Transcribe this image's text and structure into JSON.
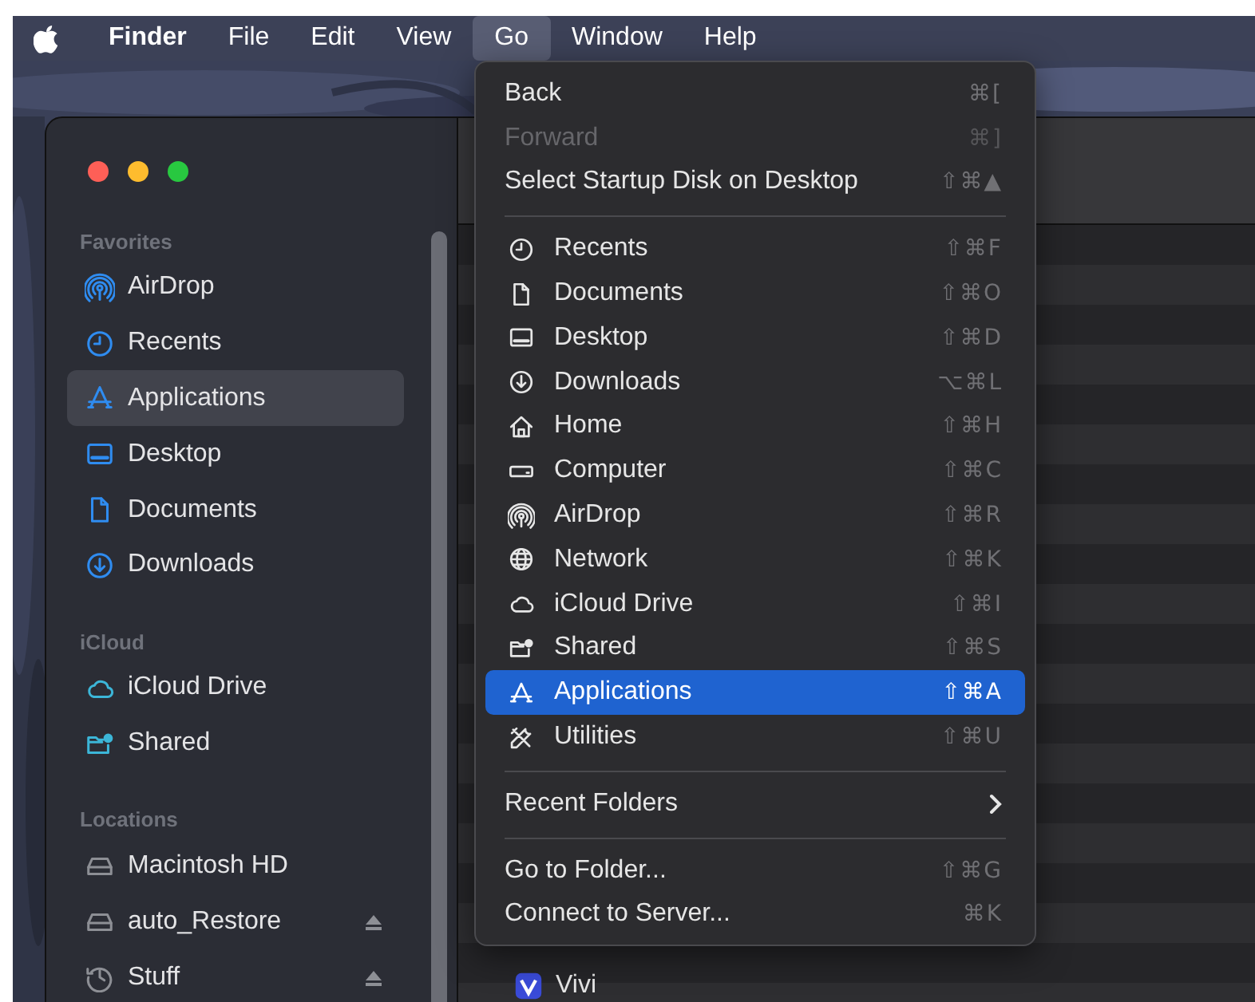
{
  "menu_bar": {
    "items": [
      {
        "label": "Finder",
        "kind": "app",
        "selected": false
      },
      {
        "label": "File",
        "kind": "menu",
        "selected": false
      },
      {
        "label": "Edit",
        "kind": "menu",
        "selected": false
      },
      {
        "label": "View",
        "kind": "menu",
        "selected": false
      },
      {
        "label": "Go",
        "kind": "menu",
        "selected": true
      },
      {
        "label": "Window",
        "kind": "menu",
        "selected": false
      },
      {
        "label": "Help",
        "kind": "menu",
        "selected": false
      }
    ]
  },
  "finder_window": {
    "sidebar": {
      "sections": [
        {
          "heading": "Favorites",
          "kind": "favorites",
          "items": [
            {
              "label": "AirDrop",
              "kind": "airdrop",
              "selected": false,
              "ejectable": false
            },
            {
              "label": "Recents",
              "kind": "clock",
              "selected": false,
              "ejectable": false
            },
            {
              "label": "Applications",
              "kind": "apps",
              "selected": true,
              "ejectable": false
            },
            {
              "label": "Desktop",
              "kind": "desktop",
              "selected": false,
              "ejectable": false
            },
            {
              "label": "Documents",
              "kind": "document",
              "selected": false,
              "ejectable": false
            },
            {
              "label": "Downloads",
              "kind": "download",
              "selected": false,
              "ejectable": false
            }
          ]
        },
        {
          "heading": "iCloud",
          "kind": "icloud",
          "items": [
            {
              "label": "iCloud Drive",
              "kind": "cloud",
              "selected": false,
              "ejectable": false
            },
            {
              "label": "Shared",
              "kind": "shared",
              "selected": false,
              "ejectable": false
            }
          ]
        },
        {
          "heading": "Locations",
          "kind": "locations",
          "items": [
            {
              "label": "Macintosh HD",
              "kind": "drive",
              "selected": false,
              "ejectable": false
            },
            {
              "label": "auto_Restore",
              "kind": "drive",
              "selected": false,
              "ejectable": true
            },
            {
              "label": "Stuff",
              "kind": "history",
              "selected": false,
              "ejectable": true
            }
          ]
        }
      ]
    },
    "files": [
      {
        "name": "Vivi"
      }
    ]
  },
  "go_menu": {
    "items": [
      {
        "kind": "plain",
        "label": "Back",
        "shortcut": "⌘[",
        "disabled": false,
        "selected": false
      },
      {
        "kind": "plain",
        "label": "Forward",
        "shortcut": "⌘]",
        "disabled": true,
        "selected": false
      },
      {
        "kind": "plain",
        "label": "Select Startup Disk on Desktop",
        "shortcut": "⇧⌘▲",
        "disabled": false,
        "selected": false
      },
      {
        "kind": "separator"
      },
      {
        "kind": "clock",
        "label": "Recents",
        "shortcut": "⇧⌘F",
        "disabled": false,
        "selected": false
      },
      {
        "kind": "document",
        "label": "Documents",
        "shortcut": "⇧⌘O",
        "disabled": false,
        "selected": false
      },
      {
        "kind": "desktop",
        "label": "Desktop",
        "shortcut": "⇧⌘D",
        "disabled": false,
        "selected": false
      },
      {
        "kind": "download",
        "label": "Downloads",
        "shortcut": "⌥⌘L",
        "disabled": false,
        "selected": false
      },
      {
        "kind": "home",
        "label": "Home",
        "shortcut": "⇧⌘H",
        "disabled": false,
        "selected": false
      },
      {
        "kind": "computer",
        "label": "Computer",
        "shortcut": "⇧⌘C",
        "disabled": false,
        "selected": false
      },
      {
        "kind": "airdrop",
        "label": "AirDrop",
        "shortcut": "⇧⌘R",
        "disabled": false,
        "selected": false
      },
      {
        "kind": "globe",
        "label": "Network",
        "shortcut": "⇧⌘K",
        "disabled": false,
        "selected": false
      },
      {
        "kind": "cloud",
        "label": "iCloud Drive",
        "shortcut": "⇧⌘I",
        "disabled": false,
        "selected": false
      },
      {
        "kind": "shared",
        "label": "Shared",
        "shortcut": "⇧⌘S",
        "disabled": false,
        "selected": false
      },
      {
        "kind": "apps",
        "label": "Applications",
        "shortcut": "⇧⌘A",
        "disabled": false,
        "selected": true
      },
      {
        "kind": "tools",
        "label": "Utilities",
        "shortcut": "⇧⌘U",
        "disabled": false,
        "selected": false
      },
      {
        "kind": "separator"
      },
      {
        "kind": "submenu",
        "label": "Recent Folders",
        "disabled": false,
        "selected": false
      },
      {
        "kind": "separator"
      },
      {
        "kind": "plain",
        "label": "Go to Folder...",
        "shortcut": "⇧⌘G",
        "disabled": false,
        "selected": false
      },
      {
        "kind": "plain",
        "label": "Connect to Server...",
        "shortcut": "⌘K",
        "disabled": false,
        "selected": false
      }
    ]
  }
}
